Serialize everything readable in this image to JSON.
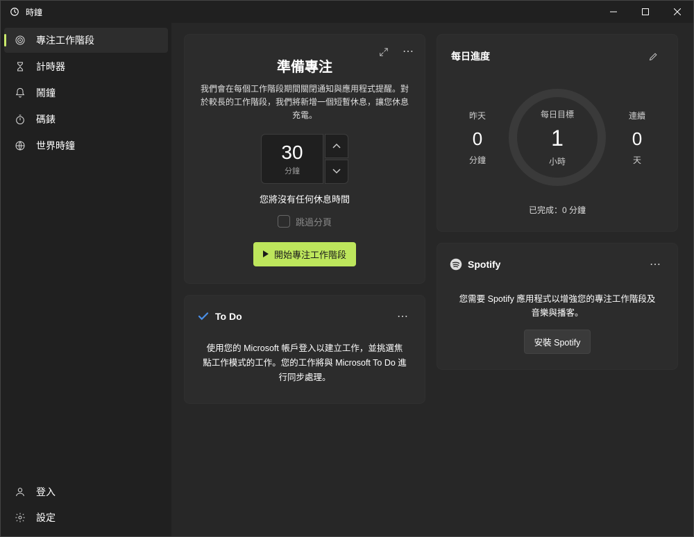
{
  "app": {
    "title": "時鐘"
  },
  "sidebar": {
    "items": [
      {
        "label": "專注工作階段"
      },
      {
        "label": "計時器"
      },
      {
        "label": "鬧鐘"
      },
      {
        "label": "碼錶"
      },
      {
        "label": "世界時鐘"
      }
    ],
    "signin": "登入",
    "settings": "設定"
  },
  "focus": {
    "title": "準備專注",
    "desc": "我們會在每個工作階段期間關閉通知與應用程式提醒。對於較長的工作階段，我們將新增一個短暫休息，讓您休息充電。",
    "value": "30",
    "unit": "分鐘",
    "break_text": "您將沒有任何休息時間",
    "skip_label": "跳過分頁",
    "start_label": "開始專注工作階段"
  },
  "todo": {
    "title": "To Do",
    "body": "使用您的 Microsoft 帳戶登入以建立工作，並挑選焦點工作模式的工作。您的工作將與 Microsoft To Do 進行同步處理。"
  },
  "progress": {
    "title": "每日進度",
    "yesterday": {
      "label": "昨天",
      "value": "0",
      "unit": "分鐘"
    },
    "goal": {
      "label": "每日目標",
      "value": "1",
      "unit": "小時"
    },
    "streak": {
      "label": "連續",
      "value": "0",
      "unit": "天"
    },
    "completed": "已完成：0 分鐘"
  },
  "spotify": {
    "title": "Spotify",
    "body": "您需要 Spotify 應用程式以增強您的專注工作階段及音樂與播客。",
    "install": "安裝 Spotify"
  }
}
